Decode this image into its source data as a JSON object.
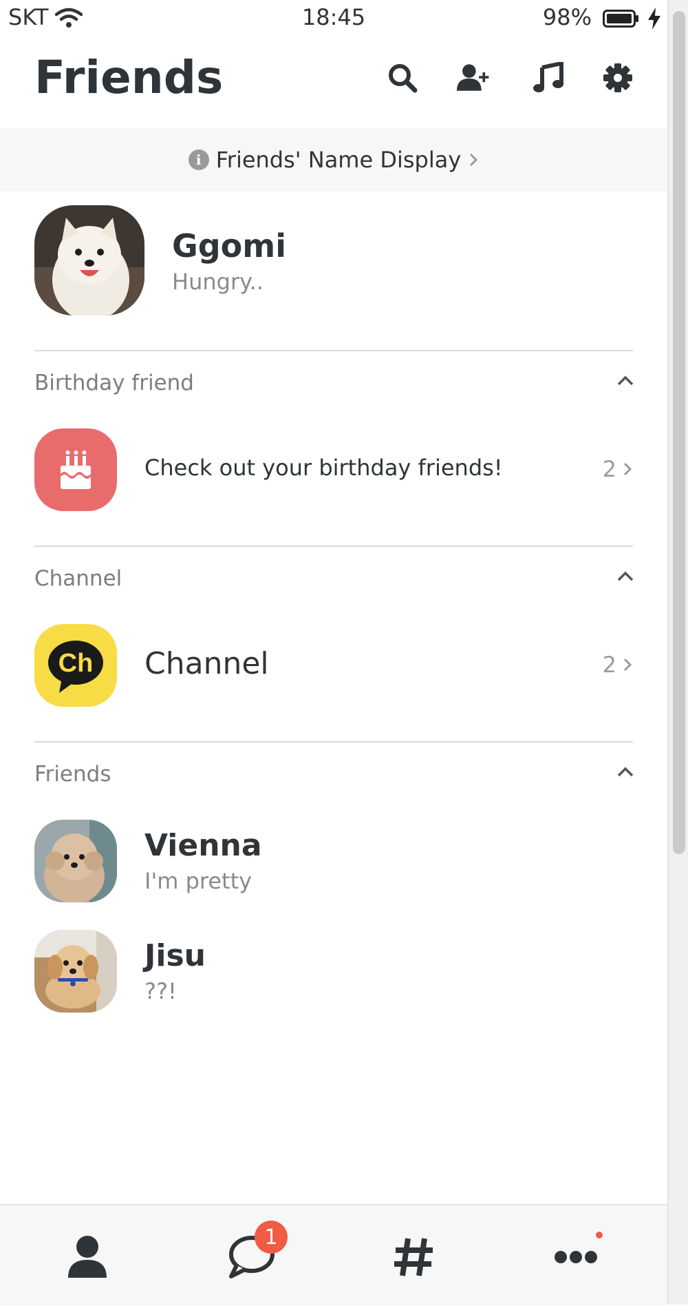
{
  "status_bar": {
    "carrier": "SKT",
    "time": "18:45",
    "battery": "98%"
  },
  "header": {
    "title": "Friends",
    "icons": [
      "search-icon",
      "add-friend-icon",
      "music-icon",
      "gear-icon"
    ]
  },
  "banner": {
    "label": "Friends' Name Display"
  },
  "profile": {
    "name": "Ggomi",
    "status": "Hungry.."
  },
  "sections": {
    "birthday": {
      "title": "Birthday friend",
      "row_text": "Check out your birthday friends!",
      "count": "2"
    },
    "channel": {
      "title": "Channel",
      "row_text": "Channel",
      "count": "2",
      "logo_text": "Ch"
    },
    "friends": {
      "title": "Friends",
      "items": [
        {
          "name": "Vienna",
          "status": "I'm pretty"
        },
        {
          "name": "Jisu",
          "status": "??!"
        }
      ]
    }
  },
  "bottom_nav": {
    "tabs": [
      "friends-tab",
      "chats-tab",
      "discover-tab",
      "more-tab"
    ],
    "chat_badge": "1"
  },
  "colors": {
    "birthday_icon_bg": "#e96c6d",
    "channel_icon_bg": "#f7dc45",
    "badge": "#f15b45",
    "text": "#2f3438"
  }
}
